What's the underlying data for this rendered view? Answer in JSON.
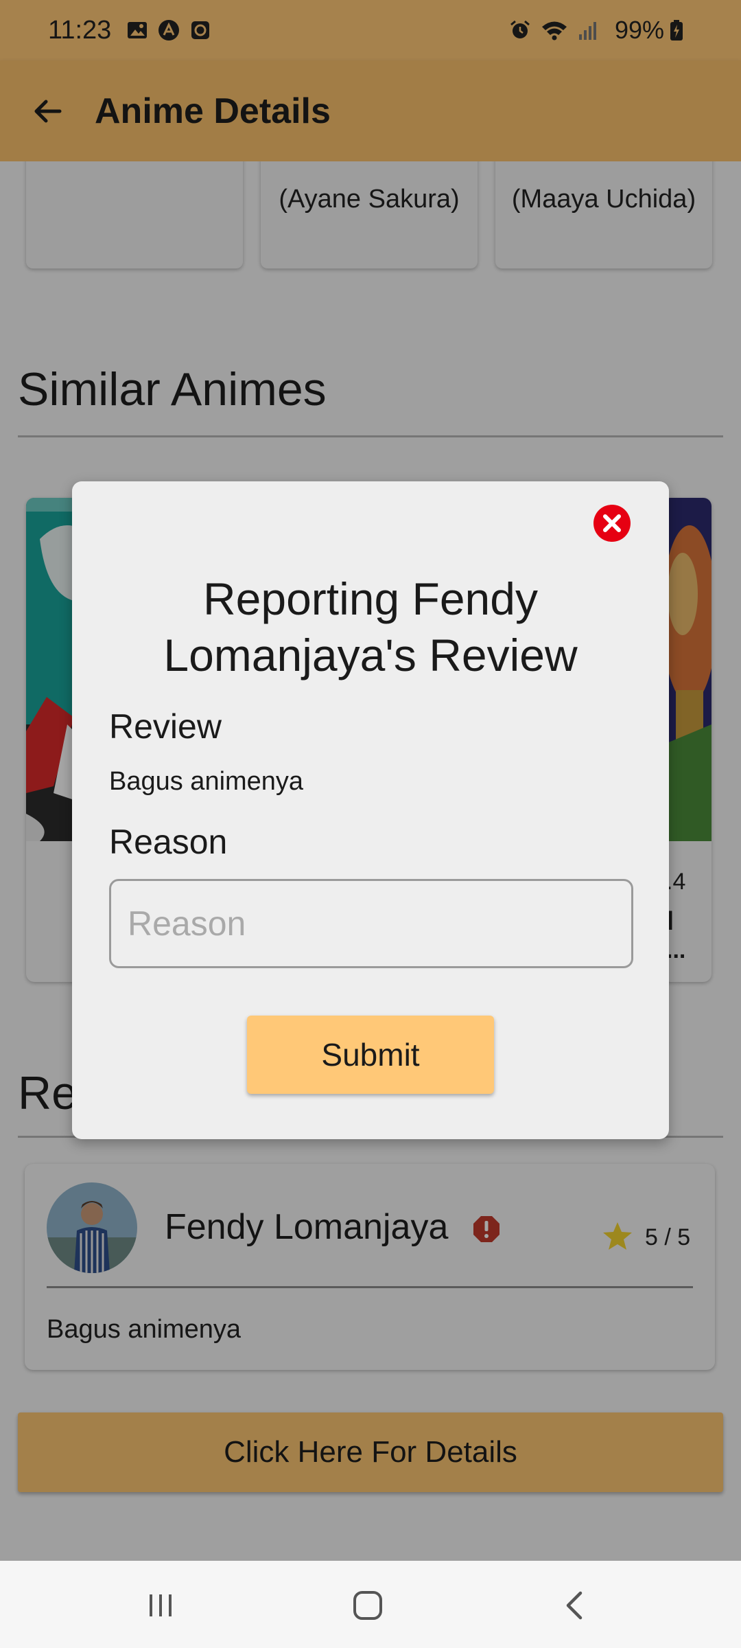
{
  "status_bar": {
    "time": "11:23",
    "battery": "99%"
  },
  "app_bar": {
    "title": "Anime Details"
  },
  "cast_cards": [
    {
      "text": ""
    },
    {
      "text": "(Ayane Sakura)"
    },
    {
      "text": "(Maaya Uchida)"
    }
  ],
  "similar_section": {
    "title": "Similar Animes",
    "partial_text_1": ".4",
    "partial_text_2": "I",
    "partial_text_3": "..."
  },
  "reviews_section": {
    "title_partial": "Re"
  },
  "review": {
    "reviewer": "Fendy Lomanjaya",
    "rating": "5 / 5",
    "text": "Bagus animenya"
  },
  "details_button": "Click Here For Details",
  "dialog": {
    "title": "Reporting Fendy Lomanjaya's Review",
    "review_label": "Review",
    "review_value": "Bagus animenya",
    "reason_label": "Reason",
    "reason_placeholder": "Reason",
    "reason_value": "",
    "submit_label": "Submit"
  },
  "colors": {
    "accent": "#ffc877",
    "app_bar": "#f9c16c",
    "close_red": "#e60012",
    "report_red": "#c0392b",
    "star": "#f2d22e"
  },
  "icons": {
    "back": "arrow-left-icon",
    "close": "close-circle-icon",
    "report": "alert-octagon-icon",
    "star": "star-icon"
  }
}
